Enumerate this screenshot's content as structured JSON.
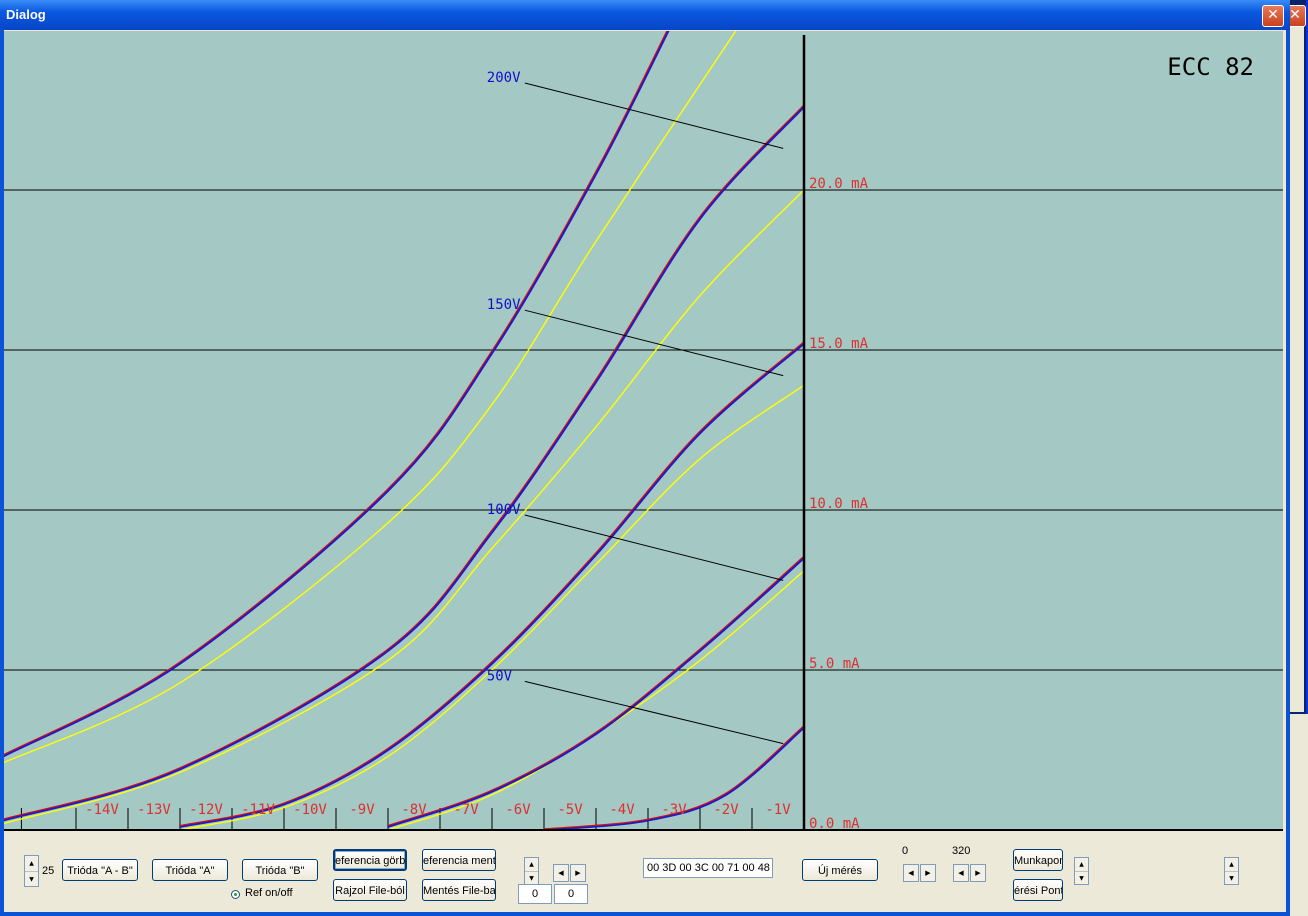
{
  "window": {
    "title": "Dialog",
    "close_glyph": "✕"
  },
  "colors": {
    "plot_bg": "#a4c8c3",
    "grid": "#000000",
    "measured": "#1a1ad0",
    "reference": "#cc1010",
    "secondary": "#ffff00",
    "current_label": "#dd3030",
    "voltage_label": "#1010cc"
  },
  "chart_data": {
    "type": "line",
    "title": "ECC 82",
    "xlim": [
      -15.4,
      0
    ],
    "ylim": [
      0,
      25
    ],
    "x_ticks": [
      "-14V",
      "-13V",
      "-12V",
      "-11V",
      "-10V",
      "-9V",
      "-8V",
      "-7V",
      "-6V",
      "-5V",
      "-4V",
      "-3V",
      "-2V",
      "-1V"
    ],
    "y_ticks": [
      {
        "value": 0,
        "label": "0.0 mA"
      },
      {
        "value": 5,
        "label": "5.0 mA"
      },
      {
        "value": 10,
        "label": "10.0 mA"
      },
      {
        "value": 15,
        "label": "15.0 mA"
      },
      {
        "value": 20,
        "label": "20.0 mA"
      }
    ],
    "grid": true,
    "series": [
      {
        "name": "200V",
        "curves": {
          "measured": [
            [
              -15.4,
              2.3
            ],
            [
              -12,
              5.2
            ],
            [
              -8,
              10.6
            ],
            [
              -6,
              14.9
            ],
            [
              -4,
              20.5
            ],
            [
              -2.6,
              25.0
            ]
          ],
          "secondary": [
            [
              -15.4,
              2.1
            ],
            [
              -12,
              4.6
            ],
            [
              -8,
              9.6
            ],
            [
              -6,
              13.3
            ],
            [
              -4,
              18.4
            ],
            [
              -1.3,
              25.0
            ]
          ]
        }
      },
      {
        "name": "150V",
        "curves": {
          "measured": [
            [
              -15.4,
              0.3
            ],
            [
              -12,
              1.9
            ],
            [
              -8,
              5.6
            ],
            [
              -6,
              9.3
            ],
            [
              -4,
              14.0
            ],
            [
              -2,
              19.1
            ],
            [
              0,
              22.6
            ]
          ],
          "secondary": [
            [
              -15.4,
              0.2
            ],
            [
              -12,
              1.8
            ],
            [
              -8,
              5.3
            ],
            [
              -6,
              8.8
            ],
            [
              -4,
              12.6
            ],
            [
              -2,
              16.7
            ],
            [
              0,
              20.0
            ]
          ]
        }
      },
      {
        "name": "100V",
        "curves": {
          "measured": [
            [
              -12,
              0.1
            ],
            [
              -10,
              0.8
            ],
            [
              -8,
              2.5
            ],
            [
              -6,
              5.2
            ],
            [
              -4,
              8.6
            ],
            [
              -2,
              12.4
            ],
            [
              0,
              15.2
            ]
          ],
          "secondary": [
            [
              -12,
              0.0
            ],
            [
              -10,
              0.7
            ],
            [
              -8,
              2.3
            ],
            [
              -6,
              5.0
            ],
            [
              -4,
              8.3
            ],
            [
              -2,
              11.6
            ],
            [
              0,
              13.9
            ]
          ]
        }
      },
      {
        "name": "50V",
        "curves": {
          "measured": [
            [
              -8,
              0.1
            ],
            [
              -6,
              1.2
            ],
            [
              -4,
              3.0
            ],
            [
              -2,
              5.6
            ],
            [
              0,
              8.5
            ]
          ],
          "secondary": [
            [
              -8,
              0.0
            ],
            [
              -6,
              1.1
            ],
            [
              -4,
              3.0
            ],
            [
              -2,
              5.3
            ],
            [
              0,
              8.1
            ]
          ]
        }
      },
      {
        "name": "",
        "curves": {
          "measured": [
            [
              -5,
              0.0
            ],
            [
              -3,
              0.3
            ],
            [
              -1.5,
              1.1
            ],
            [
              0,
              3.2
            ]
          ]
        }
      }
    ]
  },
  "controls": {
    "spin_value": "25",
    "btn_trioda_ab": "Trióda \"A - B\"",
    "btn_trioda_a": "Trióda  \"A\"",
    "btn_trioda_b": "Trióda  \"B\"",
    "btn_ref_gorbe": "eferencia görb",
    "btn_ref_mentes": "eferencia menté",
    "btn_rajzol": "Rajzol File-ból",
    "btn_mentes": "Mentés File-ba",
    "radio_ref": "Ref on/off",
    "edit_1": "0",
    "edit_2": "0",
    "hex_field": "00 3D 00 3C 00 71 00 48",
    "btn_uj_meres": "Új mérés",
    "label_0": "0",
    "label_320": "320",
    "btn_munkapont": "Munkapon",
    "btn_meresi_pont": "érési Pont"
  }
}
